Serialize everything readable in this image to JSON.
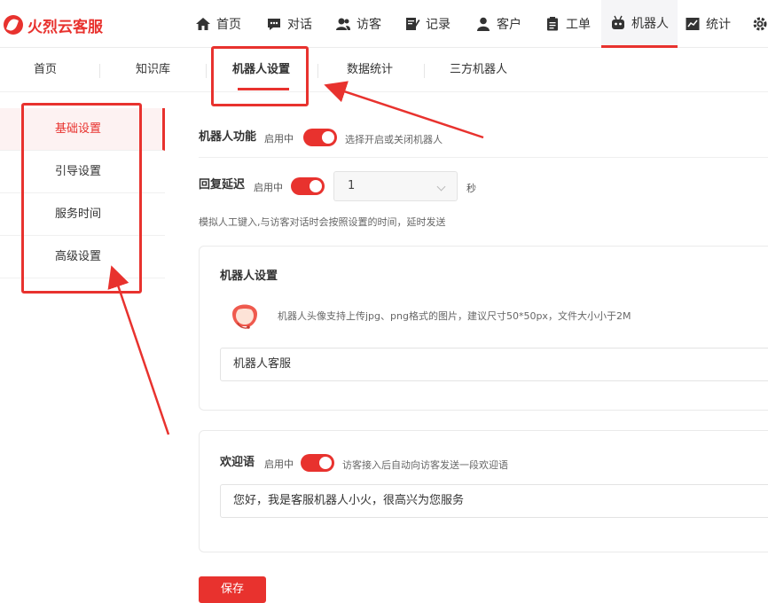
{
  "brand": {
    "name": "火烈云客服",
    "color": "#e8322e"
  },
  "nav": [
    {
      "label": "首页",
      "icon": "home-icon"
    },
    {
      "label": "对话",
      "icon": "chat-icon"
    },
    {
      "label": "访客",
      "icon": "visitor-icon"
    },
    {
      "label": "记录",
      "icon": "record-icon"
    },
    {
      "label": "客户",
      "icon": "customer-icon"
    },
    {
      "label": "工单",
      "icon": "ticket-icon"
    },
    {
      "label": "机器人",
      "icon": "robot-icon",
      "active": true
    },
    {
      "label": "统计",
      "icon": "stats-icon"
    }
  ],
  "subtabs": [
    {
      "label": "首页"
    },
    {
      "label": "知识库"
    },
    {
      "label": "机器人设置",
      "active": true
    },
    {
      "label": "数据统计"
    },
    {
      "label": "三方机器人"
    }
  ],
  "side_menu": [
    {
      "label": "基础设置",
      "active": true
    },
    {
      "label": "引导设置"
    },
    {
      "label": "服务时间"
    },
    {
      "label": "高级设置"
    }
  ],
  "form": {
    "robot_function": {
      "label": "机器人功能",
      "status": "启用中",
      "enabled": true,
      "tip": "选择开启或关闭机器人"
    },
    "reply_delay": {
      "label": "回复延迟",
      "status": "启用中",
      "enabled": true,
      "value": "1",
      "unit": "秒",
      "tip": "模拟人工键入,与访客对话时会按照设置的时间，延时发送"
    },
    "robot_settings": {
      "title": "机器人设置",
      "avatar_tip": "机器人头像支持上传jpg、png格式的图片，建议尺寸50*50px，文件大小小于2M",
      "name_value": "机器人客服"
    },
    "welcome": {
      "label": "欢迎语",
      "status": "启用中",
      "enabled": true,
      "tip": "访客接入后自动向访客发送一段欢迎语",
      "message": "您好，我是客服机器人小火，很高兴为您服务"
    },
    "save_label": "保存"
  }
}
